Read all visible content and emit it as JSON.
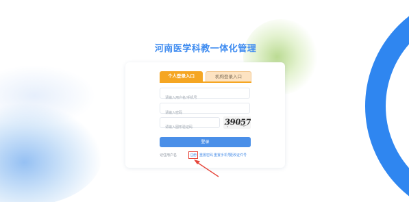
{
  "page": {
    "title": "河南医学科教一体化管理"
  },
  "tabs": [
    {
      "label": "个人登录入口",
      "active": true
    },
    {
      "label": "机构登录入口",
      "active": false
    }
  ],
  "form": {
    "username_placeholder": "请输入用户名/手机号",
    "password_placeholder": "请输入密码",
    "captcha_placeholder": "请输入图形验证码",
    "captcha_code": "39057",
    "login_label": "登录"
  },
  "links": {
    "remember": "记住用户名",
    "register": "注册",
    "reset_password": "重置密码",
    "reset_phone": "重置手机号",
    "change_id": "更改证件号"
  },
  "colors": {
    "accent_blue": "#4a8fe8",
    "tab_orange": "#f5a623",
    "annotation_red": "#e6453a"
  }
}
